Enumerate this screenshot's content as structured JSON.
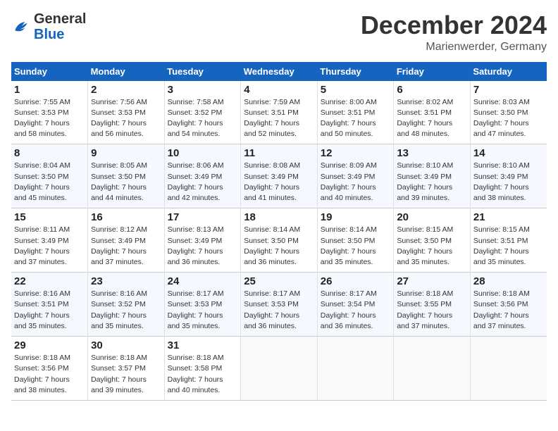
{
  "header": {
    "logo_general": "General",
    "logo_blue": "Blue",
    "title": "December 2024",
    "subtitle": "Marienwerder, Germany"
  },
  "columns": [
    "Sunday",
    "Monday",
    "Tuesday",
    "Wednesday",
    "Thursday",
    "Friday",
    "Saturday"
  ],
  "weeks": [
    [
      {
        "day": "1",
        "sunrise": "7:55 AM",
        "sunset": "3:53 PM",
        "daylight": "7 hours and 58 minutes."
      },
      {
        "day": "2",
        "sunrise": "7:56 AM",
        "sunset": "3:53 PM",
        "daylight": "7 hours and 56 minutes."
      },
      {
        "day": "3",
        "sunrise": "7:58 AM",
        "sunset": "3:52 PM",
        "daylight": "7 hours and 54 minutes."
      },
      {
        "day": "4",
        "sunrise": "7:59 AM",
        "sunset": "3:51 PM",
        "daylight": "7 hours and 52 minutes."
      },
      {
        "day": "5",
        "sunrise": "8:00 AM",
        "sunset": "3:51 PM",
        "daylight": "7 hours and 50 minutes."
      },
      {
        "day": "6",
        "sunrise": "8:02 AM",
        "sunset": "3:51 PM",
        "daylight": "7 hours and 48 minutes."
      },
      {
        "day": "7",
        "sunrise": "8:03 AM",
        "sunset": "3:50 PM",
        "daylight": "7 hours and 47 minutes."
      }
    ],
    [
      {
        "day": "8",
        "sunrise": "8:04 AM",
        "sunset": "3:50 PM",
        "daylight": "7 hours and 45 minutes."
      },
      {
        "day": "9",
        "sunrise": "8:05 AM",
        "sunset": "3:50 PM",
        "daylight": "7 hours and 44 minutes."
      },
      {
        "day": "10",
        "sunrise": "8:06 AM",
        "sunset": "3:49 PM",
        "daylight": "7 hours and 42 minutes."
      },
      {
        "day": "11",
        "sunrise": "8:08 AM",
        "sunset": "3:49 PM",
        "daylight": "7 hours and 41 minutes."
      },
      {
        "day": "12",
        "sunrise": "8:09 AM",
        "sunset": "3:49 PM",
        "daylight": "7 hours and 40 minutes."
      },
      {
        "day": "13",
        "sunrise": "8:10 AM",
        "sunset": "3:49 PM",
        "daylight": "7 hours and 39 minutes."
      },
      {
        "day": "14",
        "sunrise": "8:10 AM",
        "sunset": "3:49 PM",
        "daylight": "7 hours and 38 minutes."
      }
    ],
    [
      {
        "day": "15",
        "sunrise": "8:11 AM",
        "sunset": "3:49 PM",
        "daylight": "7 hours and 37 minutes."
      },
      {
        "day": "16",
        "sunrise": "8:12 AM",
        "sunset": "3:49 PM",
        "daylight": "7 hours and 37 minutes."
      },
      {
        "day": "17",
        "sunrise": "8:13 AM",
        "sunset": "3:49 PM",
        "daylight": "7 hours and 36 minutes."
      },
      {
        "day": "18",
        "sunrise": "8:14 AM",
        "sunset": "3:50 PM",
        "daylight": "7 hours and 36 minutes."
      },
      {
        "day": "19",
        "sunrise": "8:14 AM",
        "sunset": "3:50 PM",
        "daylight": "7 hours and 35 minutes."
      },
      {
        "day": "20",
        "sunrise": "8:15 AM",
        "sunset": "3:50 PM",
        "daylight": "7 hours and 35 minutes."
      },
      {
        "day": "21",
        "sunrise": "8:15 AM",
        "sunset": "3:51 PM",
        "daylight": "7 hours and 35 minutes."
      }
    ],
    [
      {
        "day": "22",
        "sunrise": "8:16 AM",
        "sunset": "3:51 PM",
        "daylight": "7 hours and 35 minutes."
      },
      {
        "day": "23",
        "sunrise": "8:16 AM",
        "sunset": "3:52 PM",
        "daylight": "7 hours and 35 minutes."
      },
      {
        "day": "24",
        "sunrise": "8:17 AM",
        "sunset": "3:53 PM",
        "daylight": "7 hours and 35 minutes."
      },
      {
        "day": "25",
        "sunrise": "8:17 AM",
        "sunset": "3:53 PM",
        "daylight": "7 hours and 36 minutes."
      },
      {
        "day": "26",
        "sunrise": "8:17 AM",
        "sunset": "3:54 PM",
        "daylight": "7 hours and 36 minutes."
      },
      {
        "day": "27",
        "sunrise": "8:18 AM",
        "sunset": "3:55 PM",
        "daylight": "7 hours and 37 minutes."
      },
      {
        "day": "28",
        "sunrise": "8:18 AM",
        "sunset": "3:56 PM",
        "daylight": "7 hours and 37 minutes."
      }
    ],
    [
      {
        "day": "29",
        "sunrise": "8:18 AM",
        "sunset": "3:56 PM",
        "daylight": "7 hours and 38 minutes."
      },
      {
        "day": "30",
        "sunrise": "8:18 AM",
        "sunset": "3:57 PM",
        "daylight": "7 hours and 39 minutes."
      },
      {
        "day": "31",
        "sunrise": "8:18 AM",
        "sunset": "3:58 PM",
        "daylight": "7 hours and 40 minutes."
      },
      null,
      null,
      null,
      null
    ]
  ],
  "labels": {
    "sunrise": "Sunrise:",
    "sunset": "Sunset:",
    "daylight": "Daylight:"
  }
}
